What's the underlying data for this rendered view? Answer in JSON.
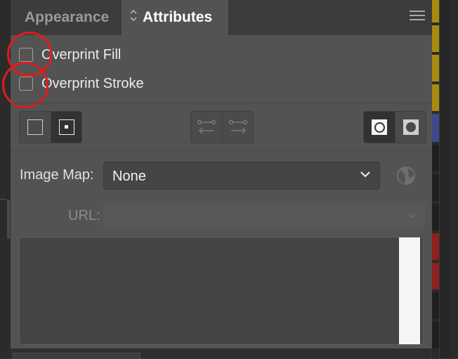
{
  "tabs": {
    "appearance": "Appearance",
    "attributes": "Attributes",
    "attributes_icon": "updown-arrows-icon",
    "menu_icon": "hamburger-menu-icon"
  },
  "overprint": {
    "fill_label": "Overprint Fill",
    "fill_checked": false,
    "stroke_label": "Overprint Stroke",
    "stroke_checked": false
  },
  "toolbar": {
    "center_group": [
      "show-center-off-icon",
      "show-center-on-icon"
    ],
    "direction_group": [
      "reverse-path-left-icon",
      "reverse-path-right-icon"
    ],
    "fill_rule_group": [
      "nonzero-winding-icon",
      "even-odd-icon"
    ]
  },
  "image_map": {
    "label": "Image Map:",
    "value": "None"
  },
  "url": {
    "label": "URL:",
    "value": ""
  },
  "notes": {
    "value": ""
  },
  "colors": {
    "annotation": "#e21b1b",
    "panel_bg": "#535353",
    "swatch_yellow": "#a88a0e",
    "swatch_blue": "#3c4a8a",
    "swatch_red": "#8e2020"
  }
}
